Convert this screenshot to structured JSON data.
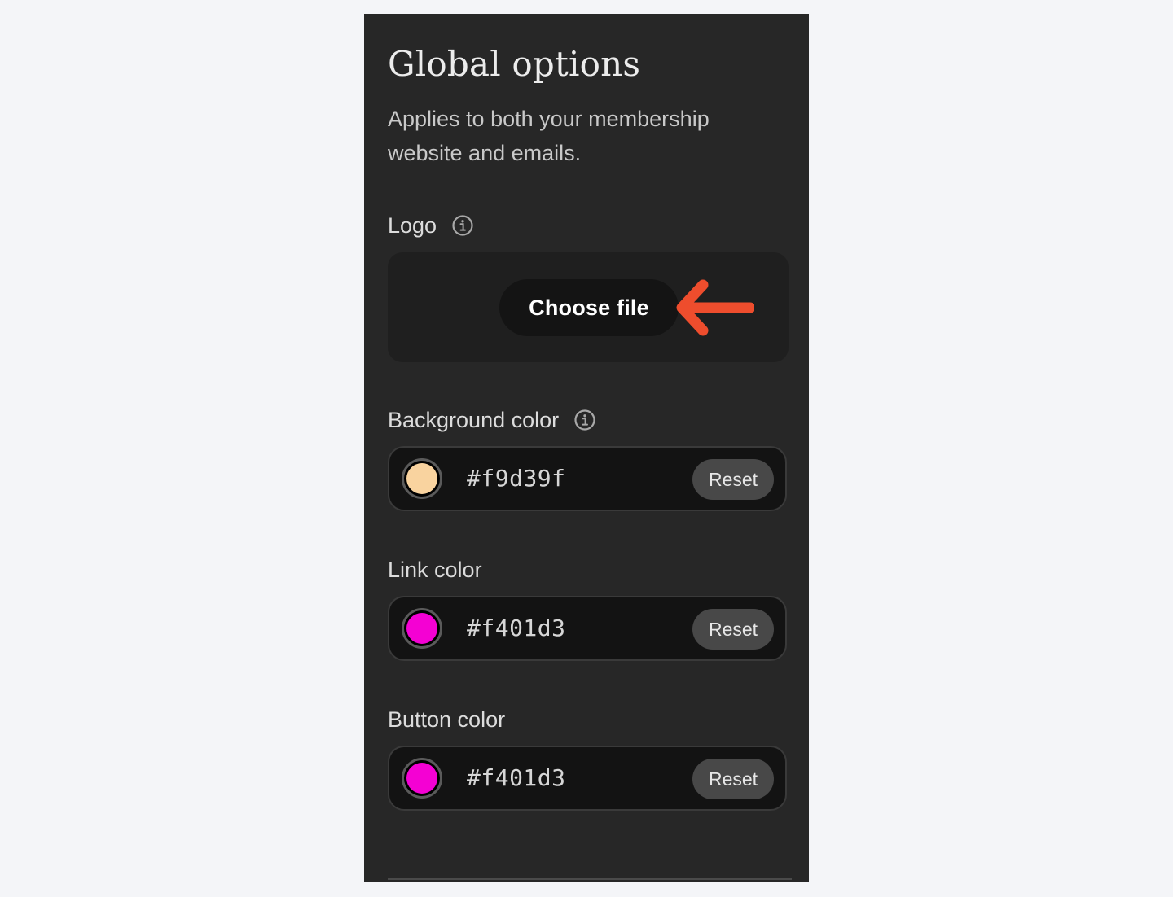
{
  "global_options": {
    "title": "Global options",
    "subtitle": "Applies to both your membership website and emails."
  },
  "logo": {
    "label": "Logo",
    "info_icon": "info-icon",
    "choose_file_label": "Choose file",
    "annotation_icon": "arrow-left-icon",
    "annotation_color": "#ee4d2d"
  },
  "background_color": {
    "label": "Background color",
    "info_icon": "info-icon",
    "value": "#f9d39f",
    "swatch": "#f9d39f",
    "reset_label": "Reset"
  },
  "link_color": {
    "label": "Link color",
    "value": "#f401d3",
    "swatch": "#f401d3",
    "reset_label": "Reset"
  },
  "button_color": {
    "label": "Button color",
    "value": "#f401d3",
    "swatch": "#f401d3",
    "reset_label": "Reset"
  }
}
